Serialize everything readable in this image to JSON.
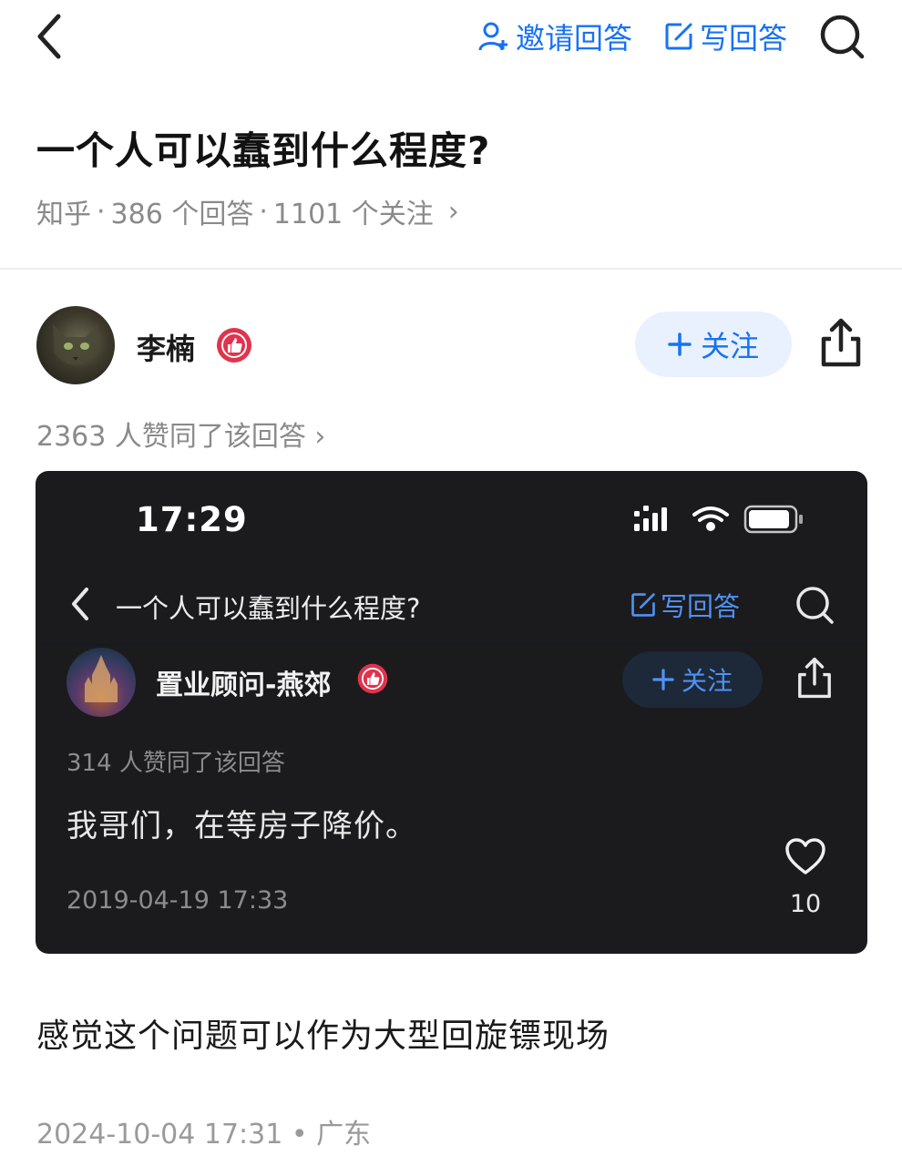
{
  "nav": {
    "invite_label": "邀请回答",
    "write_label": "写回答"
  },
  "question": {
    "title": "一个人可以蠢到什么程度?",
    "source": "知乎",
    "answers": "386 个回答",
    "followers": "1101 个关注",
    "separator": "·",
    "chevron": "›"
  },
  "answer": {
    "author": "李楠",
    "follow_label": "关注",
    "upvote_text": "2363 人赞同了该回答 ›",
    "text": "感觉这个问题可以作为大型回旋镖现场",
    "date": "2024-10-04 17:31 • 广东"
  },
  "embedded": {
    "time": "17:29",
    "title": "一个人可以蠢到什么程度?",
    "write_label": "写回答",
    "author": "置业顾问-燕郊",
    "follow_label": "关注",
    "upvote_text": "314 人赞同了该回答",
    "body": "我哥们，在等房子降价。",
    "date": "2019-04-19 17:33",
    "like_count": "10"
  },
  "colors": {
    "accent": "#1772f6",
    "accent_dark_mode": "#4f92f5",
    "badge_red": "#e0334e"
  },
  "icons": [
    "back-icon",
    "invite-person-icon",
    "edit-icon",
    "search-icon",
    "thumbs-up-badge-icon",
    "plus-icon",
    "share-icon",
    "heart-icon",
    "signal-icon",
    "wifi-icon",
    "battery-icon"
  ]
}
